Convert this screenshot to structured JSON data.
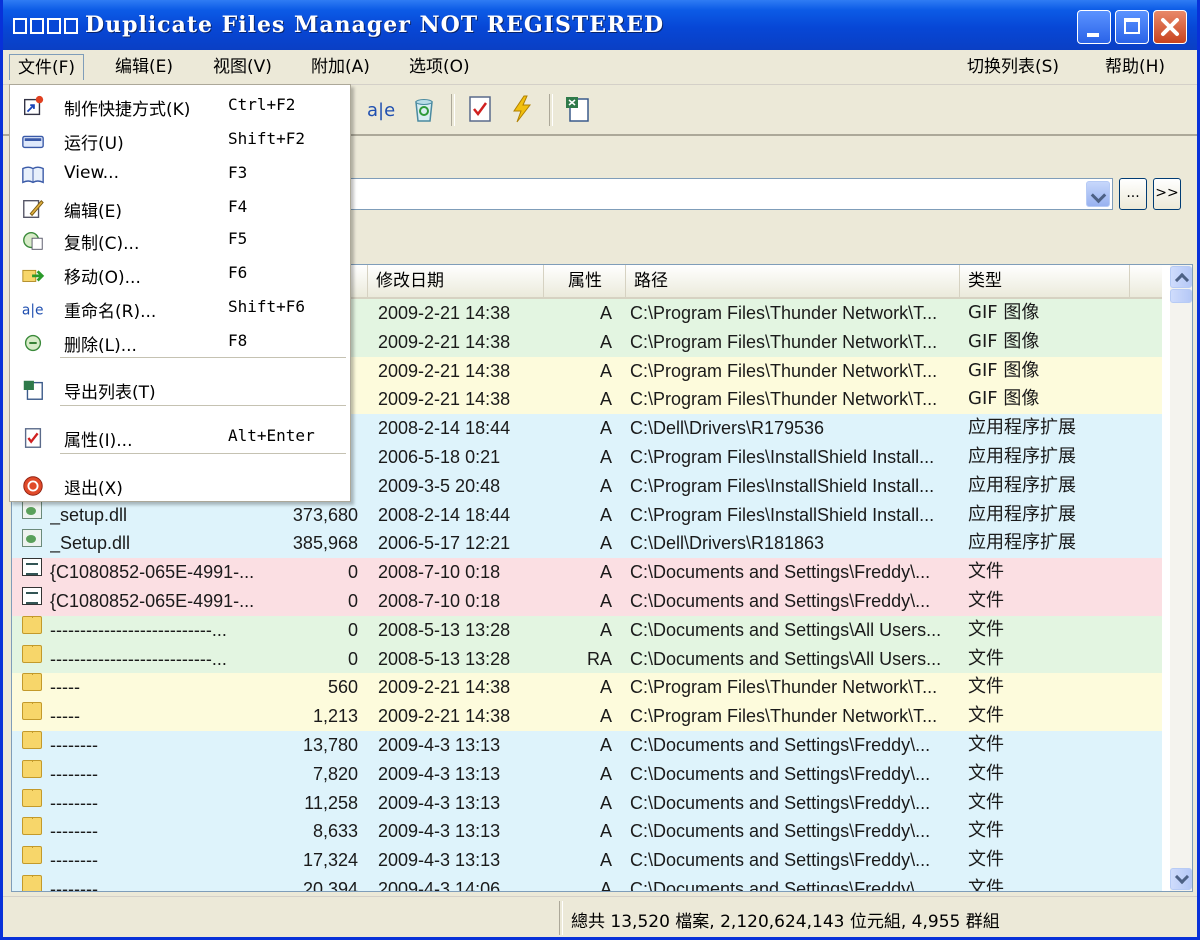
{
  "window": {
    "title": "Duplicate Files Manager NOT REGISTERED"
  },
  "menubar": {
    "file": "文件(F)",
    "edit": "编辑(E)",
    "view": "视图(V)",
    "addon": "附加(A)",
    "options": "选项(O)",
    "switch_list": "切换列表(S)",
    "help": "帮助(H)"
  },
  "file_menu": [
    {
      "label": "制作快捷方式(K)",
      "shortcut": "Ctrl+F2",
      "icon": "shortcut-icon"
    },
    {
      "label": "运行(U)",
      "shortcut": "Shift+F2",
      "icon": "run-icon"
    },
    {
      "label": "View...",
      "shortcut": "F3",
      "icon": "view-icon"
    },
    {
      "label": "编辑(E)",
      "shortcut": "F4",
      "icon": "edit-icon"
    },
    {
      "label": "复制(C)...",
      "shortcut": "F5",
      "icon": "copy-icon"
    },
    {
      "label": "移动(O)...",
      "shortcut": "F6",
      "icon": "move-icon"
    },
    {
      "label": "重命名(R)...",
      "shortcut": "Shift+F6",
      "icon": "rename-icon"
    },
    {
      "label": "删除(L)...",
      "shortcut": "F8",
      "icon": "delete-icon"
    },
    {
      "label": "导出列表(T)",
      "shortcut": "",
      "icon": "export-icon"
    },
    {
      "label": "属性(I)...",
      "shortcut": "Alt+Enter",
      "icon": "properties-icon"
    },
    {
      "label": "退出(X)",
      "shortcut": "",
      "icon": "exit-icon"
    }
  ],
  "toolbar_visible_icons": [
    "rename-icon",
    "recycle-icon",
    "properties-icon",
    "lightning-icon",
    "export-icon"
  ],
  "toolbar": {
    "rename_glyph": "a|e"
  },
  "path_buttons": {
    "browse": "...",
    "go": ">>"
  },
  "columns": {
    "name": "",
    "size": "",
    "date": "修改日期",
    "attr": "属性",
    "path": "路径",
    "type": "类型"
  },
  "colors": {
    "green": "#e3f5e1",
    "yellow": "#fdfbdc",
    "blue": "#def3fb",
    "red": "#fbdfe3"
  },
  "rows": [
    {
      "name": "",
      "size": "",
      "date": "2009-2-21  14:38",
      "attr": "A",
      "path": "C:\\Program Files\\Thunder Network\\T...",
      "type": "GIF 图像",
      "color": "green",
      "icon": "none"
    },
    {
      "name": "",
      "size": "",
      "date": "2009-2-21  14:38",
      "attr": "A",
      "path": "C:\\Program Files\\Thunder Network\\T...",
      "type": "GIF 图像",
      "color": "green",
      "icon": "none"
    },
    {
      "name": "",
      "size": "",
      "date": "2009-2-21  14:38",
      "attr": "A",
      "path": "C:\\Program Files\\Thunder Network\\T...",
      "type": "GIF 图像",
      "color": "yellow",
      "icon": "none"
    },
    {
      "name": "",
      "size": "",
      "date": "2009-2-21  14:38",
      "attr": "A",
      "path": "C:\\Program Files\\Thunder Network\\T...",
      "type": "GIF 图像",
      "color": "yellow",
      "icon": "none"
    },
    {
      "name": "",
      "size": "",
      "date": "2008-2-14  18:44",
      "attr": "A",
      "path": "C:\\Dell\\Drivers\\R179536",
      "type": "应用程序扩展",
      "color": "blue",
      "icon": "none"
    },
    {
      "name": "",
      "size": "",
      "date": "2006-5-18  0:21",
      "attr": "A",
      "path": "C:\\Program Files\\InstallShield Install...",
      "type": "应用程序扩展",
      "color": "blue",
      "icon": "none"
    },
    {
      "name": "",
      "size": "",
      "date": "2009-3-5  20:48",
      "attr": "A",
      "path": "C:\\Program Files\\InstallShield Install...",
      "type": "应用程序扩展",
      "color": "blue",
      "icon": "none"
    },
    {
      "name": "_setup.dll",
      "size": "373,680",
      "date": "2008-2-14  18:44",
      "attr": "A",
      "path": "C:\\Program Files\\InstallShield Install...",
      "type": "应用程序扩展",
      "color": "blue",
      "icon": "dll"
    },
    {
      "name": "_Setup.dll",
      "size": "385,968",
      "date": "2006-5-17  12:21",
      "attr": "A",
      "path": "C:\\Dell\\Drivers\\R181863",
      "type": "应用程序扩展",
      "color": "blue",
      "icon": "dll"
    },
    {
      "name": "{C1080852-065E-4991-...",
      "size": "0",
      "date": "2008-7-10  0:18",
      "attr": "A",
      "path": "C:\\Documents and Settings\\Freddy\\...",
      "type": "文件",
      "color": "red",
      "icon": "doc"
    },
    {
      "name": "{C1080852-065E-4991-...",
      "size": "0",
      "date": "2008-7-10  0:18",
      "attr": "A",
      "path": "C:\\Documents and Settings\\Freddy\\...",
      "type": "文件",
      "color": "red",
      "icon": "doc"
    },
    {
      "name": "---------------------------...",
      "size": "0",
      "date": "2008-5-13  13:28",
      "attr": "A",
      "path": "C:\\Documents and Settings\\All Users...",
      "type": "文件",
      "color": "green",
      "icon": "folder"
    },
    {
      "name": "---------------------------...",
      "size": "0",
      "date": "2008-5-13  13:28",
      "attr": "RA",
      "path": "C:\\Documents and Settings\\All Users...",
      "type": "文件",
      "color": "green",
      "icon": "folder"
    },
    {
      "name": "-----",
      "size": "560",
      "date": "2009-2-21  14:38",
      "attr": "A",
      "path": "C:\\Program Files\\Thunder Network\\T...",
      "type": "文件",
      "color": "yellow",
      "icon": "folder"
    },
    {
      "name": "-----",
      "size": "1,213",
      "date": "2009-2-21  14:38",
      "attr": "A",
      "path": "C:\\Program Files\\Thunder Network\\T...",
      "type": "文件",
      "color": "yellow",
      "icon": "folder"
    },
    {
      "name": "--------",
      "size": "13,780",
      "date": "2009-4-3  13:13",
      "attr": "A",
      "path": "C:\\Documents and Settings\\Freddy\\...",
      "type": "文件",
      "color": "blue",
      "icon": "folder"
    },
    {
      "name": "--------",
      "size": "7,820",
      "date": "2009-4-3  13:13",
      "attr": "A",
      "path": "C:\\Documents and Settings\\Freddy\\...",
      "type": "文件",
      "color": "blue",
      "icon": "folder"
    },
    {
      "name": "--------",
      "size": "11,258",
      "date": "2009-4-3  13:13",
      "attr": "A",
      "path": "C:\\Documents and Settings\\Freddy\\...",
      "type": "文件",
      "color": "blue",
      "icon": "folder"
    },
    {
      "name": "--------",
      "size": "8,633",
      "date": "2009-4-3  13:13",
      "attr": "A",
      "path": "C:\\Documents and Settings\\Freddy\\...",
      "type": "文件",
      "color": "blue",
      "icon": "folder"
    },
    {
      "name": "--------",
      "size": "17,324",
      "date": "2009-4-3  13:13",
      "attr": "A",
      "path": "C:\\Documents and Settings\\Freddy\\...",
      "type": "文件",
      "color": "blue",
      "icon": "folder"
    },
    {
      "name": "--------",
      "size": "20,394",
      "date": "2009-4-3  14:06",
      "attr": "A",
      "path": "C:\\Documents and Settings\\Freddy\\...",
      "type": "文件",
      "color": "blue",
      "icon": "folder"
    }
  ],
  "status": {
    "text": "總共 13,520 檔案, 2,120,624,143 位元組, 4,955 群組"
  }
}
